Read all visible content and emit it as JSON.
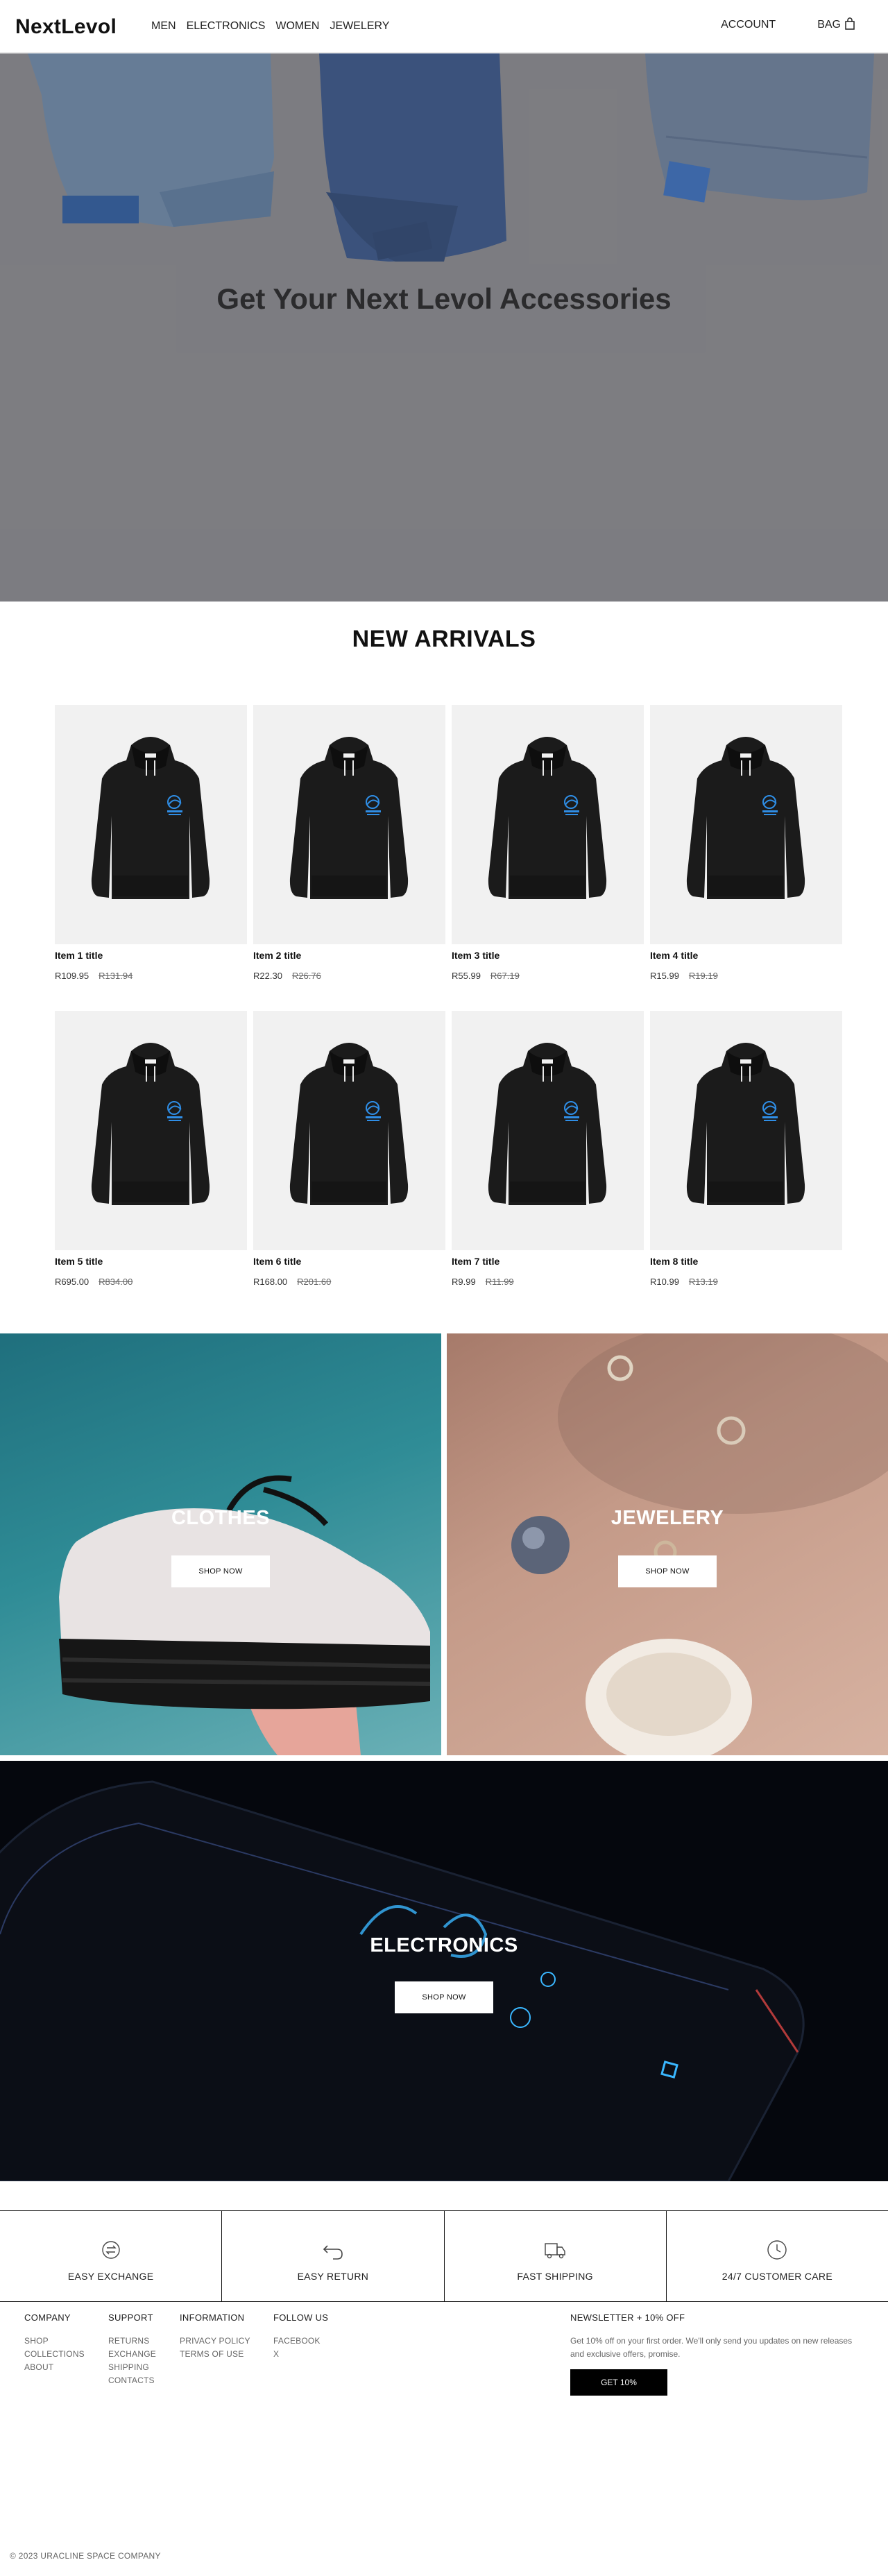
{
  "header": {
    "logo": "NextLevol",
    "nav": [
      "MEN",
      "ELECTRONICS",
      "WOMEN",
      "JEWELERY"
    ],
    "account_label": "ACCOUNT",
    "bag_label": "BAG"
  },
  "hero": {
    "title": "Get Your Next Levol Accessories"
  },
  "new_arrivals": {
    "title": "NEW ARRIVALS",
    "items": [
      {
        "title": "Item 1 title",
        "price": "R109.95",
        "old_price": "R131.94"
      },
      {
        "title": "Item 2 title",
        "price": "R22.30",
        "old_price": "R26.76"
      },
      {
        "title": "Item 3 title",
        "price": "R55.99",
        "old_price": "R67.19"
      },
      {
        "title": "Item 4 title",
        "price": "R15.99",
        "old_price": "R19.19"
      },
      {
        "title": "Item 5 title",
        "price": "R695.00",
        "old_price": "R834.00"
      },
      {
        "title": "Item 6 title",
        "price": "R168.00",
        "old_price": "R201.60"
      },
      {
        "title": "Item 7 title",
        "price": "R9.99",
        "old_price": "R11.99"
      },
      {
        "title": "Item 8 title",
        "price": "R10.99",
        "old_price": "R13.19"
      }
    ]
  },
  "categories": {
    "clothes": {
      "label": "CLOTHES",
      "button": "SHOP NOW"
    },
    "jewelery": {
      "label": "JEWELERY",
      "button": "SHOP NOW"
    },
    "electronics": {
      "label": "ELECTRONICS",
      "button": "SHOP NOW"
    }
  },
  "services": [
    {
      "label": "EASY EXCHANGE",
      "icon": "exchange-icon"
    },
    {
      "label": "EASY RETURN",
      "icon": "return-arrow-icon"
    },
    {
      "label": "FAST SHIPPING",
      "icon": "truck-icon"
    },
    {
      "label": "24/7 CUSTOMER CARE",
      "icon": "clock-icon"
    }
  ],
  "footer": {
    "company": {
      "title": "COMPANY",
      "links": [
        "SHOP",
        "COLLECTIONS",
        "ABOUT"
      ]
    },
    "support": {
      "title": "SUPPORT",
      "links": [
        "RETURNS",
        "EXCHANGE",
        "SHIPPING",
        "CONTACTS"
      ]
    },
    "information": {
      "title": "INFORMATION",
      "links": [
        "PRIVACY POLICY",
        "TERMS OF USE"
      ]
    },
    "follow": {
      "title": "FOLLOW US",
      "links": [
        "FACEBOOK",
        "X"
      ]
    },
    "newsletter": {
      "title": "NEWSLETTER + 10% OFF",
      "text": "Get 10% off on your first order. We'll only send you updates on new releases and exclusive offers, promise.",
      "button": "GET 10%"
    },
    "copyright": "© 2023 URACLINE SPACE COMPANY"
  }
}
